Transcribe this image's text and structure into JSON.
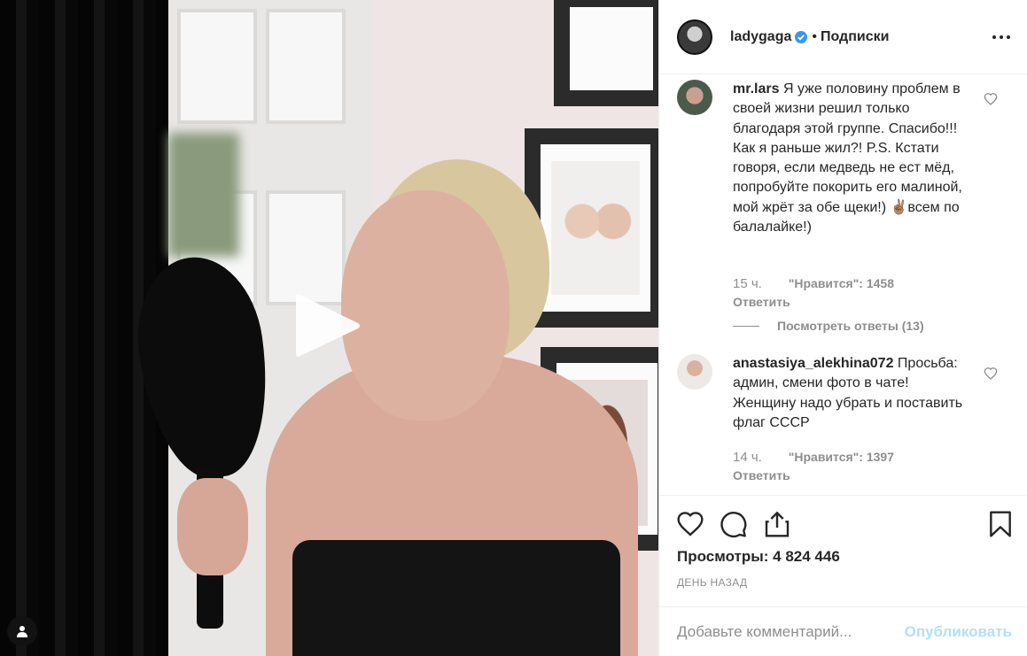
{
  "post": {
    "username": "ladygaga",
    "follow_separator": "•",
    "follow_label": "Подписки",
    "views_label": "Просмотры:",
    "views_value": "4 824 446",
    "date": "ДЕНЬ НАЗАД"
  },
  "comments": [
    {
      "user": "mr.lars",
      "text": "Я уже половину проблем в своей жизни решил только благодаря этой группе. Спасибо!!! Как я раньше жил?! P.S. Кстати говоря, если медведь не ест мёд, попробуйте покорить его малиной, мой жрёт за обе щеки!) ✌🏽всем по балалайке!)",
      "time": "15 ч.",
      "likes_label": "\"Нравится\":",
      "likes": "1458",
      "reply": "Ответить",
      "view_replies": "Посмотреть ответы (13)"
    },
    {
      "user": "anastasiya_alekhina072",
      "text": "Просьба: админ, смени фото в чате! Женщину надо убрать и поставить флаг СССР",
      "time": "14 ч.",
      "likes_label": "\"Нравится\":",
      "likes": "1397",
      "reply": "Ответить"
    }
  ],
  "comment_box": {
    "placeholder": "Добавьте комментарий...",
    "publish": "Опубликовать"
  },
  "colors": {
    "verified": "#3897f0",
    "publish_disabled": "#b2dffc",
    "muted": "#8e8e8e"
  },
  "icons": [
    "play-icon",
    "user-tag-icon",
    "verified-icon",
    "more-options-icon",
    "heart-icon",
    "comment-icon",
    "share-icon",
    "bookmark-icon"
  ]
}
